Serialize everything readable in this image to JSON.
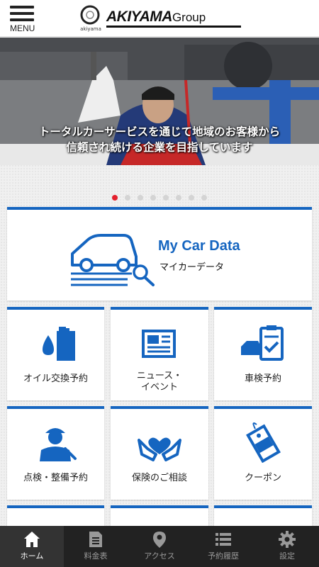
{
  "header": {
    "menu_label": "MENU",
    "logo_sub": "akiyama",
    "logo_main": "AKIYAMA",
    "logo_group": "Group"
  },
  "hero": {
    "line1": "トータルカーサービスを通じて地域のお客様から",
    "line2": "信頼され続ける企業を目指しています"
  },
  "carousel": {
    "total": 8,
    "active": 0
  },
  "mycar": {
    "title": "My Car Data",
    "subtitle": "マイカーデータ"
  },
  "tiles": [
    {
      "label": "オイル交換予約",
      "icon": "oil-icon"
    },
    {
      "label": "ニュース・\nイベント",
      "icon": "news-icon"
    },
    {
      "label": "車検予約",
      "icon": "inspection-icon"
    },
    {
      "label": "点検・整備予約",
      "icon": "mechanic-icon"
    },
    {
      "label": "保険のご相談",
      "icon": "insurance-hands-icon"
    },
    {
      "label": "クーポン",
      "icon": "coupon-icon"
    }
  ],
  "nav": [
    {
      "label": "ホーム",
      "icon": "home-icon",
      "active": true
    },
    {
      "label": "料金表",
      "icon": "price-list-icon",
      "active": false
    },
    {
      "label": "アクセス",
      "icon": "location-pin-icon",
      "active": false
    },
    {
      "label": "予約履歴",
      "icon": "history-list-icon",
      "active": false
    },
    {
      "label": "設定",
      "icon": "gear-icon",
      "active": false
    }
  ],
  "colors": {
    "accent": "#1565c0",
    "active_dot": "#e4202d",
    "nav_bg": "#222222"
  }
}
